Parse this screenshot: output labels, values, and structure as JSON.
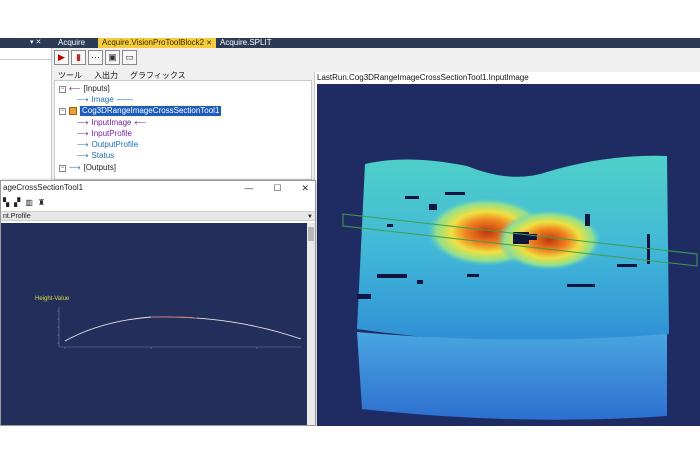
{
  "tabs": [
    {
      "label": "Acquire",
      "active": false
    },
    {
      "label": "Acquire.VisionProToolBlock2",
      "active": true
    },
    {
      "label": "Acquire.SPLIT",
      "active": false
    }
  ],
  "left_panel": {
    "toolbar_icons": [
      "run-icon",
      "record-icon",
      "dots-icon",
      "image-icon",
      "panel-icon"
    ],
    "subtabs": [
      "ツール",
      "入出力",
      "グラフィックス"
    ]
  },
  "tree": {
    "inputs_label": "[Inputs]",
    "image_label": "Image",
    "tool_label": "Cog3DRangeImageCrossSectionTool1",
    "input_image_label": "InputImage",
    "input_profile_label": "InputProfile",
    "output_profile_label": "OutputProfile",
    "status_label": "Status",
    "outputs_label": "[Outputs]"
  },
  "image_view": {
    "title": "LastRun.Cog3DRangeImageCrossSectionTool1.InputImage"
  },
  "floating_window": {
    "title": "ageCrossSectionTool1",
    "subbar": "nt.Profile"
  },
  "profile_plot": {
    "legend": "Height-Value"
  },
  "colors": {
    "tab_strip": "#2b3a55",
    "active_tab": "#f5cc3c",
    "selection": "#1d5bbf",
    "image_background": "#1f2c63",
    "plot_background": "#222f5a",
    "profile_line": "#e8e4e4",
    "legend_text": "#e0d64a"
  }
}
